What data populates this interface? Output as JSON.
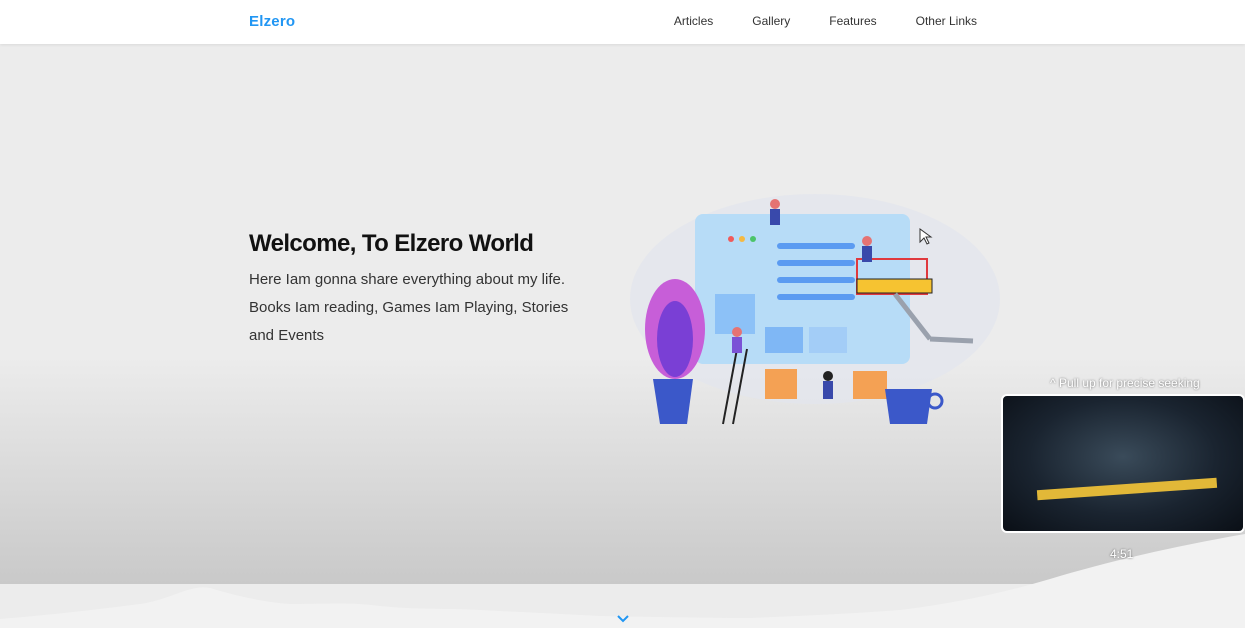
{
  "navbar": {
    "logo": "Elzero",
    "links": [
      "Articles",
      "Gallery",
      "Features",
      "Other Links"
    ]
  },
  "hero": {
    "title": "Welcome, To Elzero World",
    "description": "Here Iam gonna share everything about my life. Books Iam reading, Games Iam Playing, Stories and Events"
  },
  "video_overlay": {
    "hint": "Pull up for precise seeking",
    "time": "4:51"
  },
  "colors": {
    "brand": "#2196f3",
    "hero_bg": "#ececec"
  },
  "icons": [
    "chevron-down-icon",
    "chevron-up-icon",
    "cursor-icon"
  ]
}
